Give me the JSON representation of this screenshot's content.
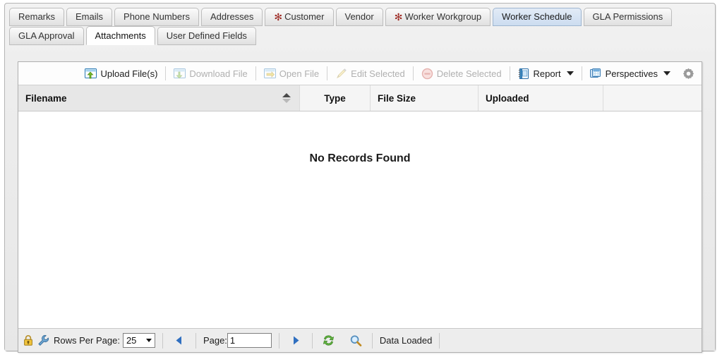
{
  "tabs": {
    "row1": [
      {
        "label": "Remarks",
        "state": "normal",
        "required": false
      },
      {
        "label": "Emails",
        "state": "normal",
        "required": false
      },
      {
        "label": "Phone Numbers",
        "state": "normal",
        "required": false
      },
      {
        "label": "Addresses",
        "state": "normal",
        "required": false
      },
      {
        "label": "Customer",
        "state": "normal",
        "required": true
      },
      {
        "label": "Vendor",
        "state": "normal",
        "required": false
      },
      {
        "label": "Worker Workgroup",
        "state": "normal",
        "required": true
      },
      {
        "label": "Worker Schedule",
        "state": "hover",
        "required": false
      },
      {
        "label": "GLA Permissions",
        "state": "normal",
        "required": false
      }
    ],
    "row2": [
      {
        "label": "GLA Approval",
        "state": "normal",
        "required": false
      },
      {
        "label": "Attachments",
        "state": "selected",
        "required": false
      },
      {
        "label": "User Defined Fields",
        "state": "normal",
        "required": false
      }
    ],
    "required_marker": "✻"
  },
  "toolbar": {
    "upload_label": "Upload File(s)",
    "download_label": "Download File",
    "open_label": "Open File",
    "edit_label": "Edit Selected",
    "delete_label": "Delete Selected",
    "report_label": "Report",
    "perspectives_label": "Perspectives",
    "upload_icon": "upload-file-icon",
    "download_icon": "download-file-icon",
    "open_icon": "open-file-icon",
    "edit_icon": "pencil-icon",
    "delete_icon": "delete-circle-icon",
    "report_icon": "report-book-icon",
    "perspectives_icon": "perspectives-windows-icon",
    "settings_icon": "gear-icon"
  },
  "grid": {
    "columns": [
      {
        "label": "Filename",
        "align": "left",
        "sorted": true
      },
      {
        "label": "Type",
        "align": "center",
        "sorted": false
      },
      {
        "label": "File Size",
        "align": "left",
        "sorted": false
      },
      {
        "label": "Uploaded",
        "align": "left",
        "sorted": false
      }
    ],
    "rows": [],
    "empty_message": "No Records Found",
    "sort_icon": "sort-arrows-icon"
  },
  "footer": {
    "lock_icon": "lock-icon",
    "wrench_icon": "wrench-icon",
    "rows_per_page_label": "Rows Per Page:",
    "rows_per_page_value": "25",
    "rows_per_page_options": [
      "25"
    ],
    "prev_icon": "previous-page-icon",
    "next_icon": "next-page-icon",
    "page_label": "Page:",
    "page_value": "1",
    "refresh_icon": "refresh-icon",
    "search_icon": "search-icon",
    "status": "Data Loaded"
  },
  "colors": {
    "accent_blue": "#2a6099",
    "required_red": "#9e2a24",
    "tab_hover": "#ccdcf0",
    "panel_bg": "#e7e7e7"
  }
}
